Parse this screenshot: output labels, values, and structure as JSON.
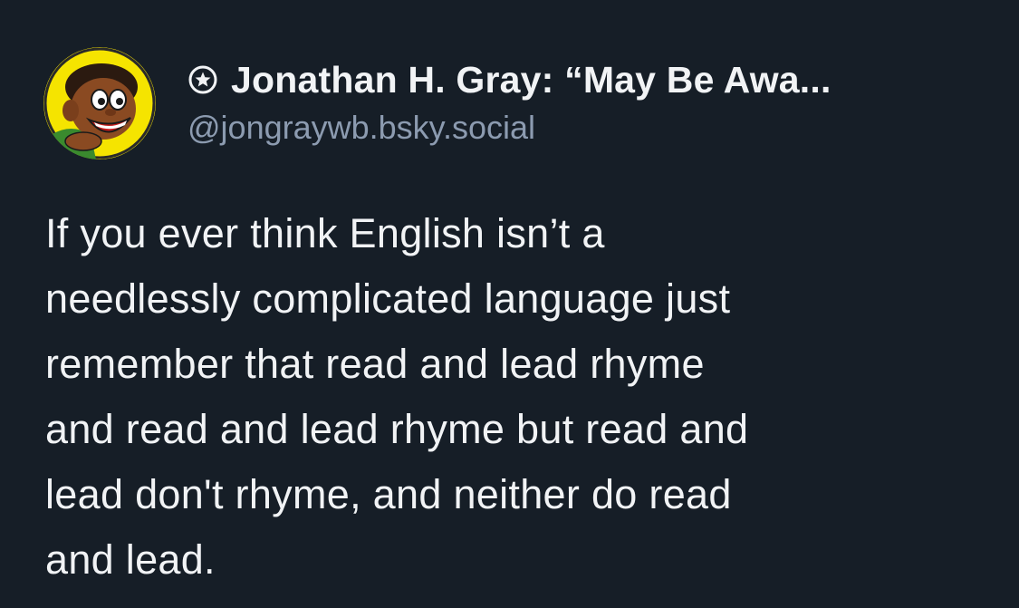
{
  "post": {
    "author": {
      "display_name": "Jonathan H. Gray: “May Be Awa...",
      "handle": "@jongraywb.bsky.social",
      "badge_icon": "star-badge-icon",
      "avatar": "cartoon-character-avatar"
    },
    "text": "If you ever think English isn’t a\nneedlessly complicated language just\nremember that read and lead rhyme\nand read and lead rhyme but read and\nlead don't rhyme, and neither do read\nand lead."
  },
  "colors": {
    "background": "#161e27",
    "text": "#f1f3f5",
    "handle": "#8c9bb0",
    "avatar_background": "#f5e400"
  }
}
